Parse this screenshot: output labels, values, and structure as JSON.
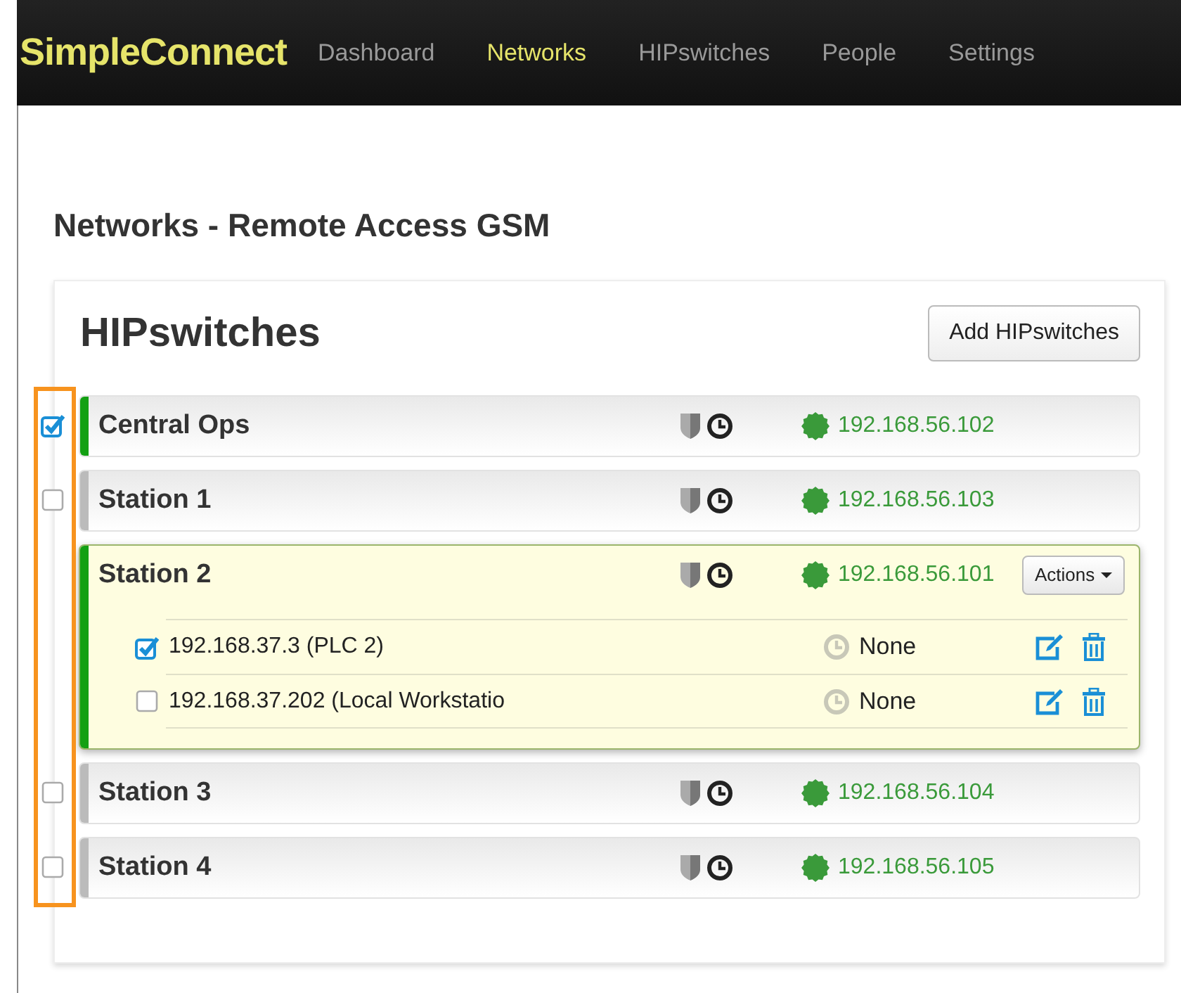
{
  "navbar": {
    "brand": "SimpleConnect",
    "links": [
      {
        "label": "Dashboard",
        "selected": false
      },
      {
        "label": "Networks",
        "selected": true
      },
      {
        "label": "HIPswitches",
        "selected": false
      },
      {
        "label": "People",
        "selected": false
      },
      {
        "label": "Settings",
        "selected": false
      }
    ]
  },
  "page_title": "Networks - Remote Access GSM",
  "panel": {
    "title": "HIPswitches",
    "add_button": "Add HIPswitches"
  },
  "hipswitches": [
    {
      "name": "Central Ops",
      "checked": true,
      "color": "#13a013",
      "ip": "192.168.56.102",
      "expanded": false
    },
    {
      "name": "Station 1",
      "checked": false,
      "color": "#bbbbbb",
      "ip": "192.168.56.103",
      "expanded": false
    },
    {
      "name": "Station 2",
      "color": "#13a013",
      "ip": "192.168.56.101",
      "expanded": true,
      "actions_button": "Actions",
      "devices": [
        {
          "name": "192.168.37.3 (PLC 2)",
          "checked": true,
          "schedule": "None"
        },
        {
          "name": "192.168.37.202 (Local Workstatio",
          "checked": false,
          "schedule": "None"
        }
      ]
    },
    {
      "name": "Station 3",
      "checked": false,
      "color": "#bbbbbb",
      "ip": "192.168.56.104",
      "expanded": false
    },
    {
      "name": "Station 4",
      "checked": false,
      "color": "#bbbbbb",
      "ip": "192.168.56.105",
      "expanded": false
    }
  ]
}
